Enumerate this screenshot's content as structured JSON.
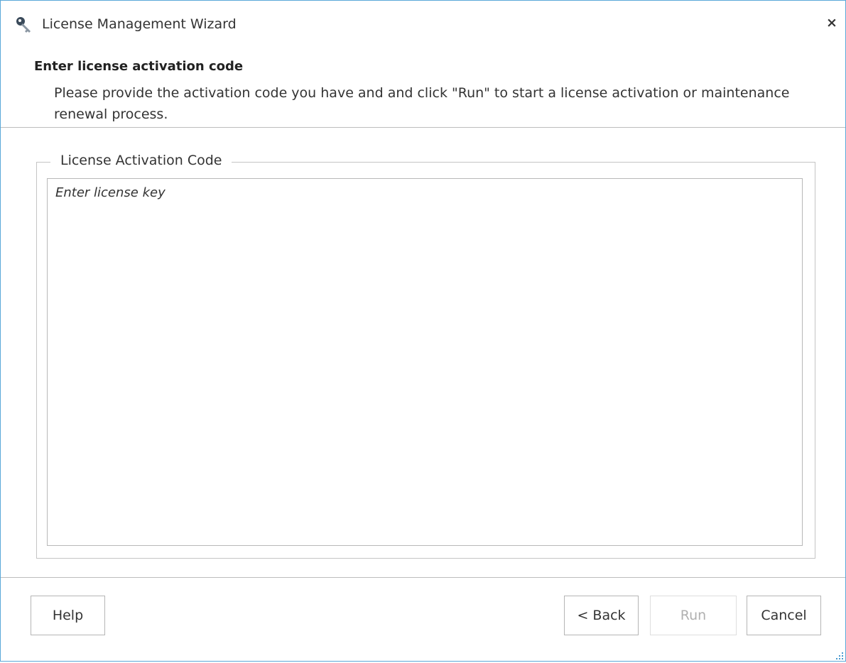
{
  "window": {
    "title": "License Management Wizard",
    "icon": "key-icon",
    "close_label": "×"
  },
  "step": {
    "title": "Enter license activation code",
    "description": "Please provide the activation code you have and and click \"Run\" to start a license activation or maintenance renewal process."
  },
  "group": {
    "label": "License Activation Code"
  },
  "license_input": {
    "value": "",
    "placeholder": "Enter license key"
  },
  "buttons": {
    "help": "Help",
    "back": "< Back",
    "run": "Run",
    "cancel": "Cancel"
  },
  "states": {
    "run_enabled": false
  },
  "colors": {
    "window_border": "#5aa8d8",
    "separator": "#bdbdbd",
    "disabled_text": "#b0b0b0"
  }
}
